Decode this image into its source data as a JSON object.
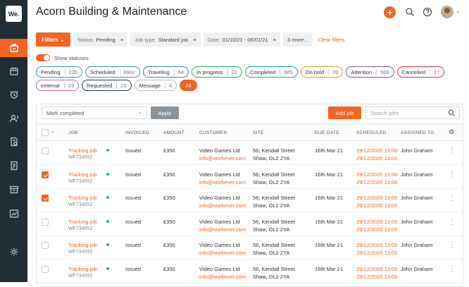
{
  "app": {
    "logo": "We.",
    "title": "Acorn Building & Maintenance"
  },
  "header": {
    "add_icon": "+",
    "search_icon": "search-icon",
    "help_icon": "help-icon",
    "avatar_chevron": "⌄"
  },
  "sidebar": {
    "items": [
      "jobs-icon",
      "calendar-icon",
      "clock-icon",
      "contacts-icon",
      "quotes-icon",
      "invoices-icon",
      "archive-icon",
      "reports-icon",
      "settings-icon"
    ]
  },
  "filters": {
    "button": "Filters ⌄",
    "chips": [
      {
        "key": "Status:",
        "value": "Pending"
      },
      {
        "key": "Job type:",
        "value": "Standard job"
      },
      {
        "key": "Date:",
        "value": "01/10/21 - 06/01/21"
      },
      {
        "key": "",
        "value": "3 more..."
      }
    ],
    "clear": "Clear filters"
  },
  "show_statuses": "Show statuses",
  "status_pills": [
    {
      "label": "Pending",
      "count": "235",
      "color": "#3a8fd9"
    },
    {
      "label": "Scheduled",
      "count": "6902",
      "color": "#3a8fd9"
    },
    {
      "label": "Traveling",
      "count": "64",
      "color": "#2e86c1"
    },
    {
      "label": "In progress",
      "count": "22",
      "color": "#27ae60"
    },
    {
      "label": "Completed",
      "count": "565",
      "color": "#1fa39a"
    },
    {
      "label": "On hold",
      "count": "26",
      "color": "#e0a030"
    },
    {
      "label": "Attention",
      "count": "565",
      "color": "#7e57c2"
    },
    {
      "label": "Cancelled",
      "count": "17",
      "color": "#d9363e"
    },
    {
      "label": "external",
      "count": "23",
      "color": "#c266c9"
    },
    {
      "label": "Requested",
      "count": "23",
      "color": "#2c3e50"
    },
    {
      "label": "Message",
      "count": "4",
      "color": "#bbbbbb"
    },
    {
      "label": "All",
      "count": "",
      "color": "#f26522"
    }
  ],
  "toolbar": {
    "bulk_action": "Mark completed",
    "apply": "Apply",
    "add_job": "Add job",
    "search_placeholder": "Search jobs"
  },
  "columns": [
    "JOB",
    "INVOICED",
    "AMOUNT",
    "CUSTOMER",
    "SITE",
    "DUE DATE",
    "SCHEDULED",
    "ASSIGNED TO"
  ],
  "rows": [
    {
      "checked": false,
      "job": "Tracking job",
      "job_id": "WF734552",
      "invoiced": "Issued",
      "amount": "£350",
      "customer": "Video Games Ltd",
      "email": "info@workever.com",
      "site1": "56, Kendall Street",
      "site2": "Shaw, OL2 2YA",
      "due": "16th Mar 21",
      "sched1": "29/12/2020 13:00",
      "sched2": "29/12/2020 13:00",
      "assigned": "John Graham"
    },
    {
      "checked": true,
      "job": "Tracking job",
      "job_id": "WF734552",
      "invoiced": "Issued",
      "amount": "£350",
      "customer": "Video Games Ltd",
      "email": "info@workever.com",
      "site1": "56, Kendall Street",
      "site2": "Shaw, OL2 2YA",
      "due": "16th Mar 21",
      "sched1": "29/12/2020 13:00",
      "sched2": "29/12/2020 13:00",
      "assigned": "John Graham"
    },
    {
      "checked": true,
      "job": "Tracking job",
      "job_id": "WF734552",
      "invoiced": "Issued",
      "amount": "£350",
      "customer": "Video Games Ltd",
      "email": "info@workever.com",
      "site1": "56, Kendall Street",
      "site2": "Shaw, OL2 2YA",
      "due": "16th Mar 21",
      "sched1": "29/12/2020 13:00",
      "sched2": "29/12/2020 13:00",
      "assigned": "John Graham"
    },
    {
      "checked": false,
      "job": "Tracking job",
      "job_id": "WF734552",
      "invoiced": "Issued",
      "amount": "£350",
      "customer": "Video Games Ltd",
      "email": "info@workever.com",
      "site1": "56, Kendall Street",
      "site2": "Shaw, OL2 2YA",
      "due": "16th Mar 21",
      "sched1": "29/12/2020 13:00",
      "sched2": "29/12/2020 13:00",
      "assigned": "John Graham"
    },
    {
      "checked": false,
      "job": "Tracking job",
      "job_id": "WF734552",
      "invoiced": "Issued",
      "amount": "£350",
      "customer": "Video Games Ltd",
      "email": "info@workever.com",
      "site1": "56, Kendall Street",
      "site2": "Shaw, OL2 2YA",
      "due": "16th Mar 21",
      "sched1": "29/12/2020 13:00",
      "sched2": "29/12/2020 13:00",
      "assigned": "John Graham"
    },
    {
      "checked": false,
      "job": "Tracking job",
      "job_id": "WF734552",
      "invoiced": "Issued",
      "amount": "£350",
      "customer": "Video Games Ltd",
      "email": "info@workever.com",
      "site1": "56, Kendall Street",
      "site2": "Shaw, OL2 2YA",
      "due": "16th Mar 21",
      "sched1": "29/12/2020 13:00",
      "sched2": "29/12/2020 13:00",
      "assigned": "John Graham"
    }
  ]
}
